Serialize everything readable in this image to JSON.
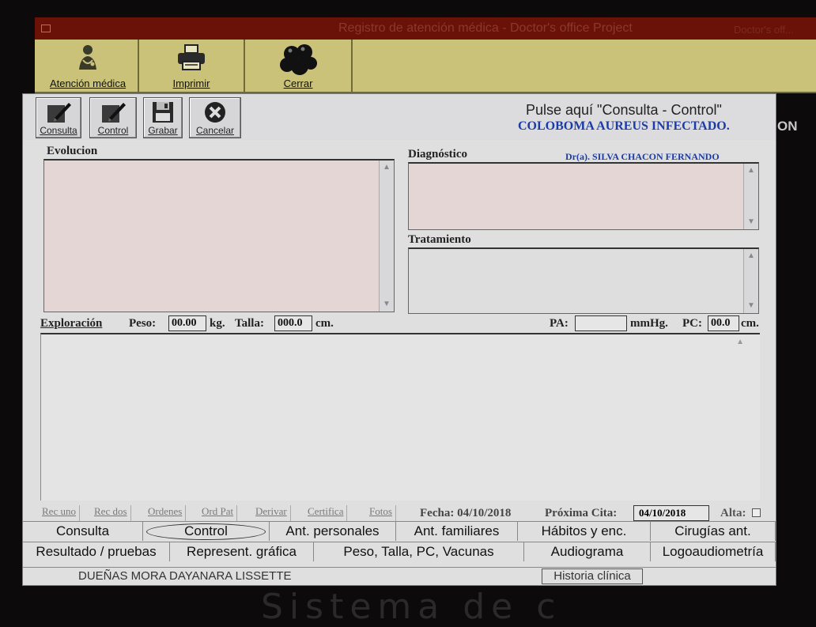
{
  "window": {
    "title": "Registro de atención médica - Doctor's office Project",
    "right_text": "Doctor's off..."
  },
  "toolbar": {
    "buttons": [
      {
        "label": "Atención médica",
        "icon": "doctor-icon"
      },
      {
        "label": "Imprimir",
        "icon": "printer-icon"
      },
      {
        "label": "Cerrar",
        "icon": "close-cluster-icon"
      }
    ]
  },
  "subtoolbar": {
    "buttons": [
      {
        "label": "Consulta",
        "icon": "edit-icon"
      },
      {
        "label": "Control",
        "icon": "edit-icon"
      },
      {
        "label": "Grabar",
        "icon": "save-icon"
      },
      {
        "label": "Cancelar",
        "icon": "cancel-icon"
      }
    ]
  },
  "header": {
    "pulse_text": "Pulse aquí \"Consulta - Control\"",
    "diagnosis_heading": "COLOBOMA AUREUS INFECTADO.",
    "doctor": "Dr(a). SILVA CHACON FERNANDO"
  },
  "sections": {
    "evolucion": "Evolucion",
    "diagnostico": "Diagnóstico",
    "tratamiento": "Tratamiento"
  },
  "exploracion": {
    "label": "Exploración",
    "peso_label": "Peso:",
    "peso_value": "00.00",
    "peso_unit": "kg.",
    "talla_label": "Talla:",
    "talla_value": "000.0",
    "talla_unit": "cm.",
    "pa_label": "PA:",
    "pa_value": "",
    "pa_unit": "mmHg.",
    "pc_label": "PC:",
    "pc_value": "00.0",
    "pc_unit": "cm."
  },
  "mini_tabs": [
    "Rec uno",
    "Rec dos",
    "Ordenes",
    "Ord Pat",
    "Derivar",
    "Certifica",
    "Fotos"
  ],
  "dates": {
    "fecha_label": "Fecha: 04/10/2018",
    "proxima_label": "Próxima Cita:",
    "proxima_value": "04/10/2018",
    "alta_label": "Alta:"
  },
  "tabs_row1": [
    "Consulta",
    "Control",
    "Ant. personales",
    "Ant. familiares",
    "Hábitos y enc.",
    "Cirugías ant."
  ],
  "tabs_row2": [
    "Resultado / pruebas",
    "Represent. gráfica",
    "Peso, Talla, PC, Vacunas",
    "Audiograma",
    "Logoaudiometría"
  ],
  "status": {
    "patient": "DUEÑAS MORA DAYANARA LISSETTE",
    "historia": "Historia clínica"
  },
  "background": {
    "side_text": "ON",
    "bottom_text": "Sistema de c"
  },
  "colors": {
    "toolbar_bg": "#c9c278",
    "title_bg": "#6a1208",
    "accent_blue": "#1a3ca8"
  }
}
